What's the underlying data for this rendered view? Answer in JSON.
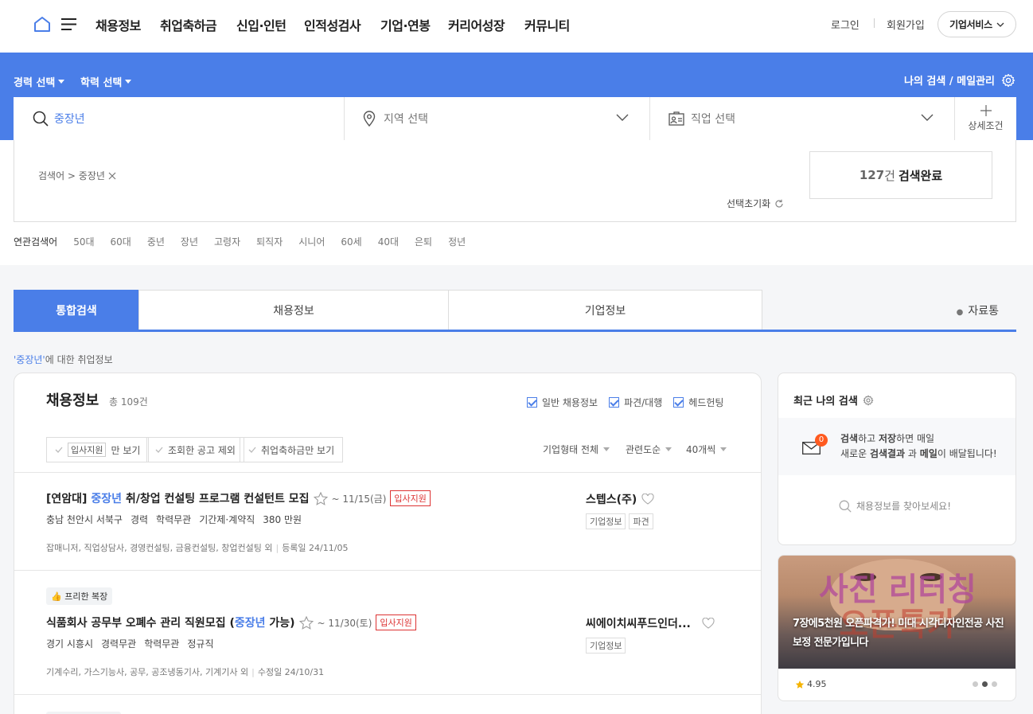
{
  "nav": {
    "menu": [
      "채용정보",
      "취업축하금",
      "신입·인턴",
      "인적성검사",
      "기업·연봉",
      "커리어성장",
      "커뮤니티"
    ],
    "login": "로그인",
    "signup": "회원가입",
    "biz_service": "기업서비스"
  },
  "search_band": {
    "career_select": "경력 선택",
    "edu_select": "학력 선택",
    "my_search": "나의 검색 / 메일관리",
    "keyword": "중장년",
    "region_placeholder": "지역 선택",
    "job_placeholder": "직업 선택",
    "detail": "상세조건"
  },
  "result": {
    "breadcrumb": "검색어 > 중장년",
    "reset": "선택초기화",
    "count": "127",
    "count_unit": "건",
    "count_label": "검색완료"
  },
  "related": {
    "label": "연관검색어",
    "terms": [
      "50대",
      "60대",
      "중년",
      "장년",
      "고령자",
      "퇴직자",
      "시니어",
      "60세",
      "40대",
      "은퇴",
      "정년"
    ]
  },
  "tabs": {
    "items": [
      "통합검색",
      "채용정보",
      "기업정보"
    ],
    "data_tab": "자료통"
  },
  "about": {
    "keyword": "'중장년'",
    "suffix": "에 대한 취업정보"
  },
  "jobs": {
    "title": "채용정보",
    "total": "총 109건",
    "checks": [
      "일반 채용정보",
      "파견/대행",
      "헤드헌팅"
    ],
    "filters": {
      "f1_tag": "입사지원",
      "f1_suffix": "만 보기",
      "f2": "조회한 공고 제외",
      "f3": "취업축하금만 보기"
    },
    "sorts": [
      "기업형태 전체",
      "관련도순",
      "40개씩"
    ],
    "items": [
      {
        "title_pre": "[연암대] ",
        "title_hl": "중장년",
        "title_post": " 취/창업 컨설팅 프로그램 컨설턴트 모집",
        "deadline": "~ 11/15(금)",
        "apply": "입사지원",
        "meta": [
          "충남 천안시 서북구",
          "경력",
          "학력무관",
          "기간제·계약직",
          "380 만원"
        ],
        "sector": "잡매니저, 직업상담사, 경영컨설팅, 금융컨설팅, 창업컨설팅 외",
        "date": "등록일 24/11/05",
        "company": "스텝스(주)",
        "ctags": [
          "기업정보",
          "파견"
        ]
      },
      {
        "benefit": "프리한 복장",
        "title_pre": "식품회사 공무부 오폐수 관리 직원모집 (",
        "title_hl": "중장년",
        "title_post": " 가능)",
        "deadline": "~ 11/30(토)",
        "apply": "입사지원",
        "meta": [
          "경기 시흥시",
          "경력무관",
          "학력무관",
          "정규직"
        ],
        "sector": "기계수리, 가스기능사, 공무, 공조냉동기사, 기계기사 외",
        "date": "수정일 24/10/31",
        "company": "씨에이치씨푸드인더...",
        "ctags": [
          "기업정보"
        ]
      }
    ]
  },
  "recent": {
    "title": "최근 나의 검색",
    "badge": "0",
    "line1_a": "검색",
    "line1_b": "하고 ",
    "line1_c": "저장",
    "line1_d": "하면 매일",
    "line2_a": "새로운 ",
    "line2_b": "검색결과",
    "line2_c": " 과 ",
    "line2_d": "메일",
    "line2_e": "이 배달됩니다!",
    "find": "채용정보를 찾아보세요!"
  },
  "ad": {
    "bg_text": "사진 리터칭",
    "bg_text2": "오픈특가",
    "headline": "7장에5천원 오픈파격가! 미대 시각디자인전공 사진보정 전문가입니다",
    "rating": "4.95"
  },
  "colors": {
    "brand_blue": "#4a7ee8",
    "apply_red": "#dd3333",
    "badge_orange": "#ff5a1f"
  }
}
